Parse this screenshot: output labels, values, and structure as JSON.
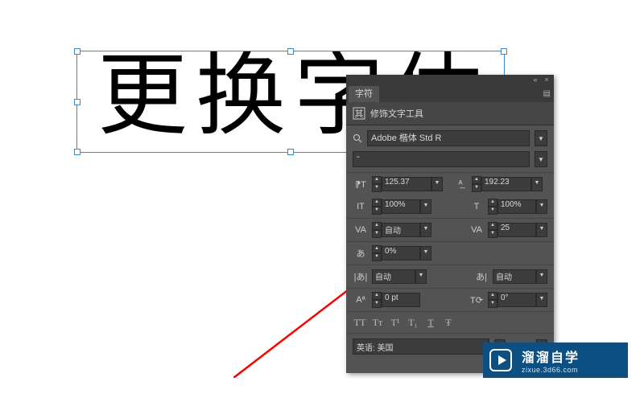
{
  "canvas": {
    "text": "更换字体"
  },
  "panel": {
    "tab": "字符",
    "touch_label": "修饰文字工具",
    "font": "Adobe 楷体 Std R",
    "style": "-",
    "size": "125.37",
    "leading": "192.23",
    "v_scale": "100%",
    "h_scale": "100%",
    "kerning": "自动",
    "tracking": "25",
    "tsume": "0%",
    "aki_left": "自动",
    "aki_right": "自动",
    "baseline": "0 pt",
    "rotate": "0°",
    "lang": "英语: 美国"
  },
  "icons": {
    "size": "⁋T",
    "leading": "ᴬ̲",
    "vscale": "IT",
    "hscale": "T",
    "kern": "VA",
    "track": "VA",
    "tsume": "あ",
    "aki": "|あ|",
    "aki2": "あ|",
    "baseline": "Aª",
    "rotate": "T⟳",
    "allcaps": "TT",
    "smallcaps": "Tᴛ",
    "super": "T¹",
    "sub": "T₁",
    "under": "T",
    "strike": "Ŧ"
  },
  "watermark": {
    "title": "溜溜自学",
    "url": "zixue.3d66.com"
  }
}
